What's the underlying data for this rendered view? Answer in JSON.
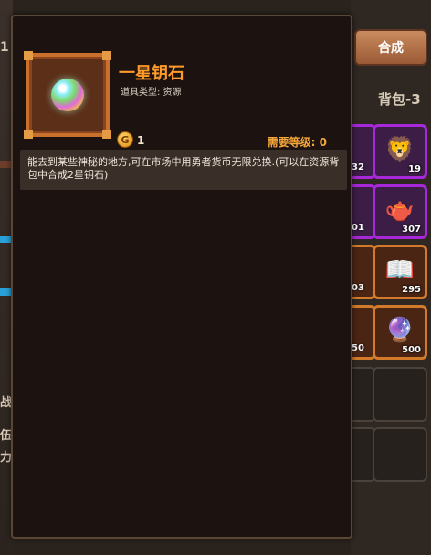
{
  "bag": {
    "compose_label": "合成",
    "bag_label": "背包-3",
    "slots": [
      {
        "count": "19"
      },
      {
        "count": "307"
      },
      {
        "count": "295"
      },
      {
        "count": "500"
      }
    ],
    "partial_counts": [
      "32",
      "01",
      "03",
      "50"
    ]
  },
  "left_fragments": [
    "1",
    "战",
    "伍",
    "力"
  ],
  "tooltip": {
    "item_name": "一星钥石",
    "item_type": "道具类型: 资源",
    "coin_symbol": "G",
    "price": "1",
    "required_level": "需要等级: 0",
    "description": "能去到某些神秘的地方,可在市场中用勇者货币无限兑换.(可以在资源背包中合成2星钥石)",
    "item_icon": "rainbow-orb-icon"
  },
  "colors": {
    "name_orange": "#ff9a2b",
    "level_orange": "#f4a63a",
    "rarity_purple": "#a728d8",
    "rarity_orange": "#d17a2a"
  }
}
